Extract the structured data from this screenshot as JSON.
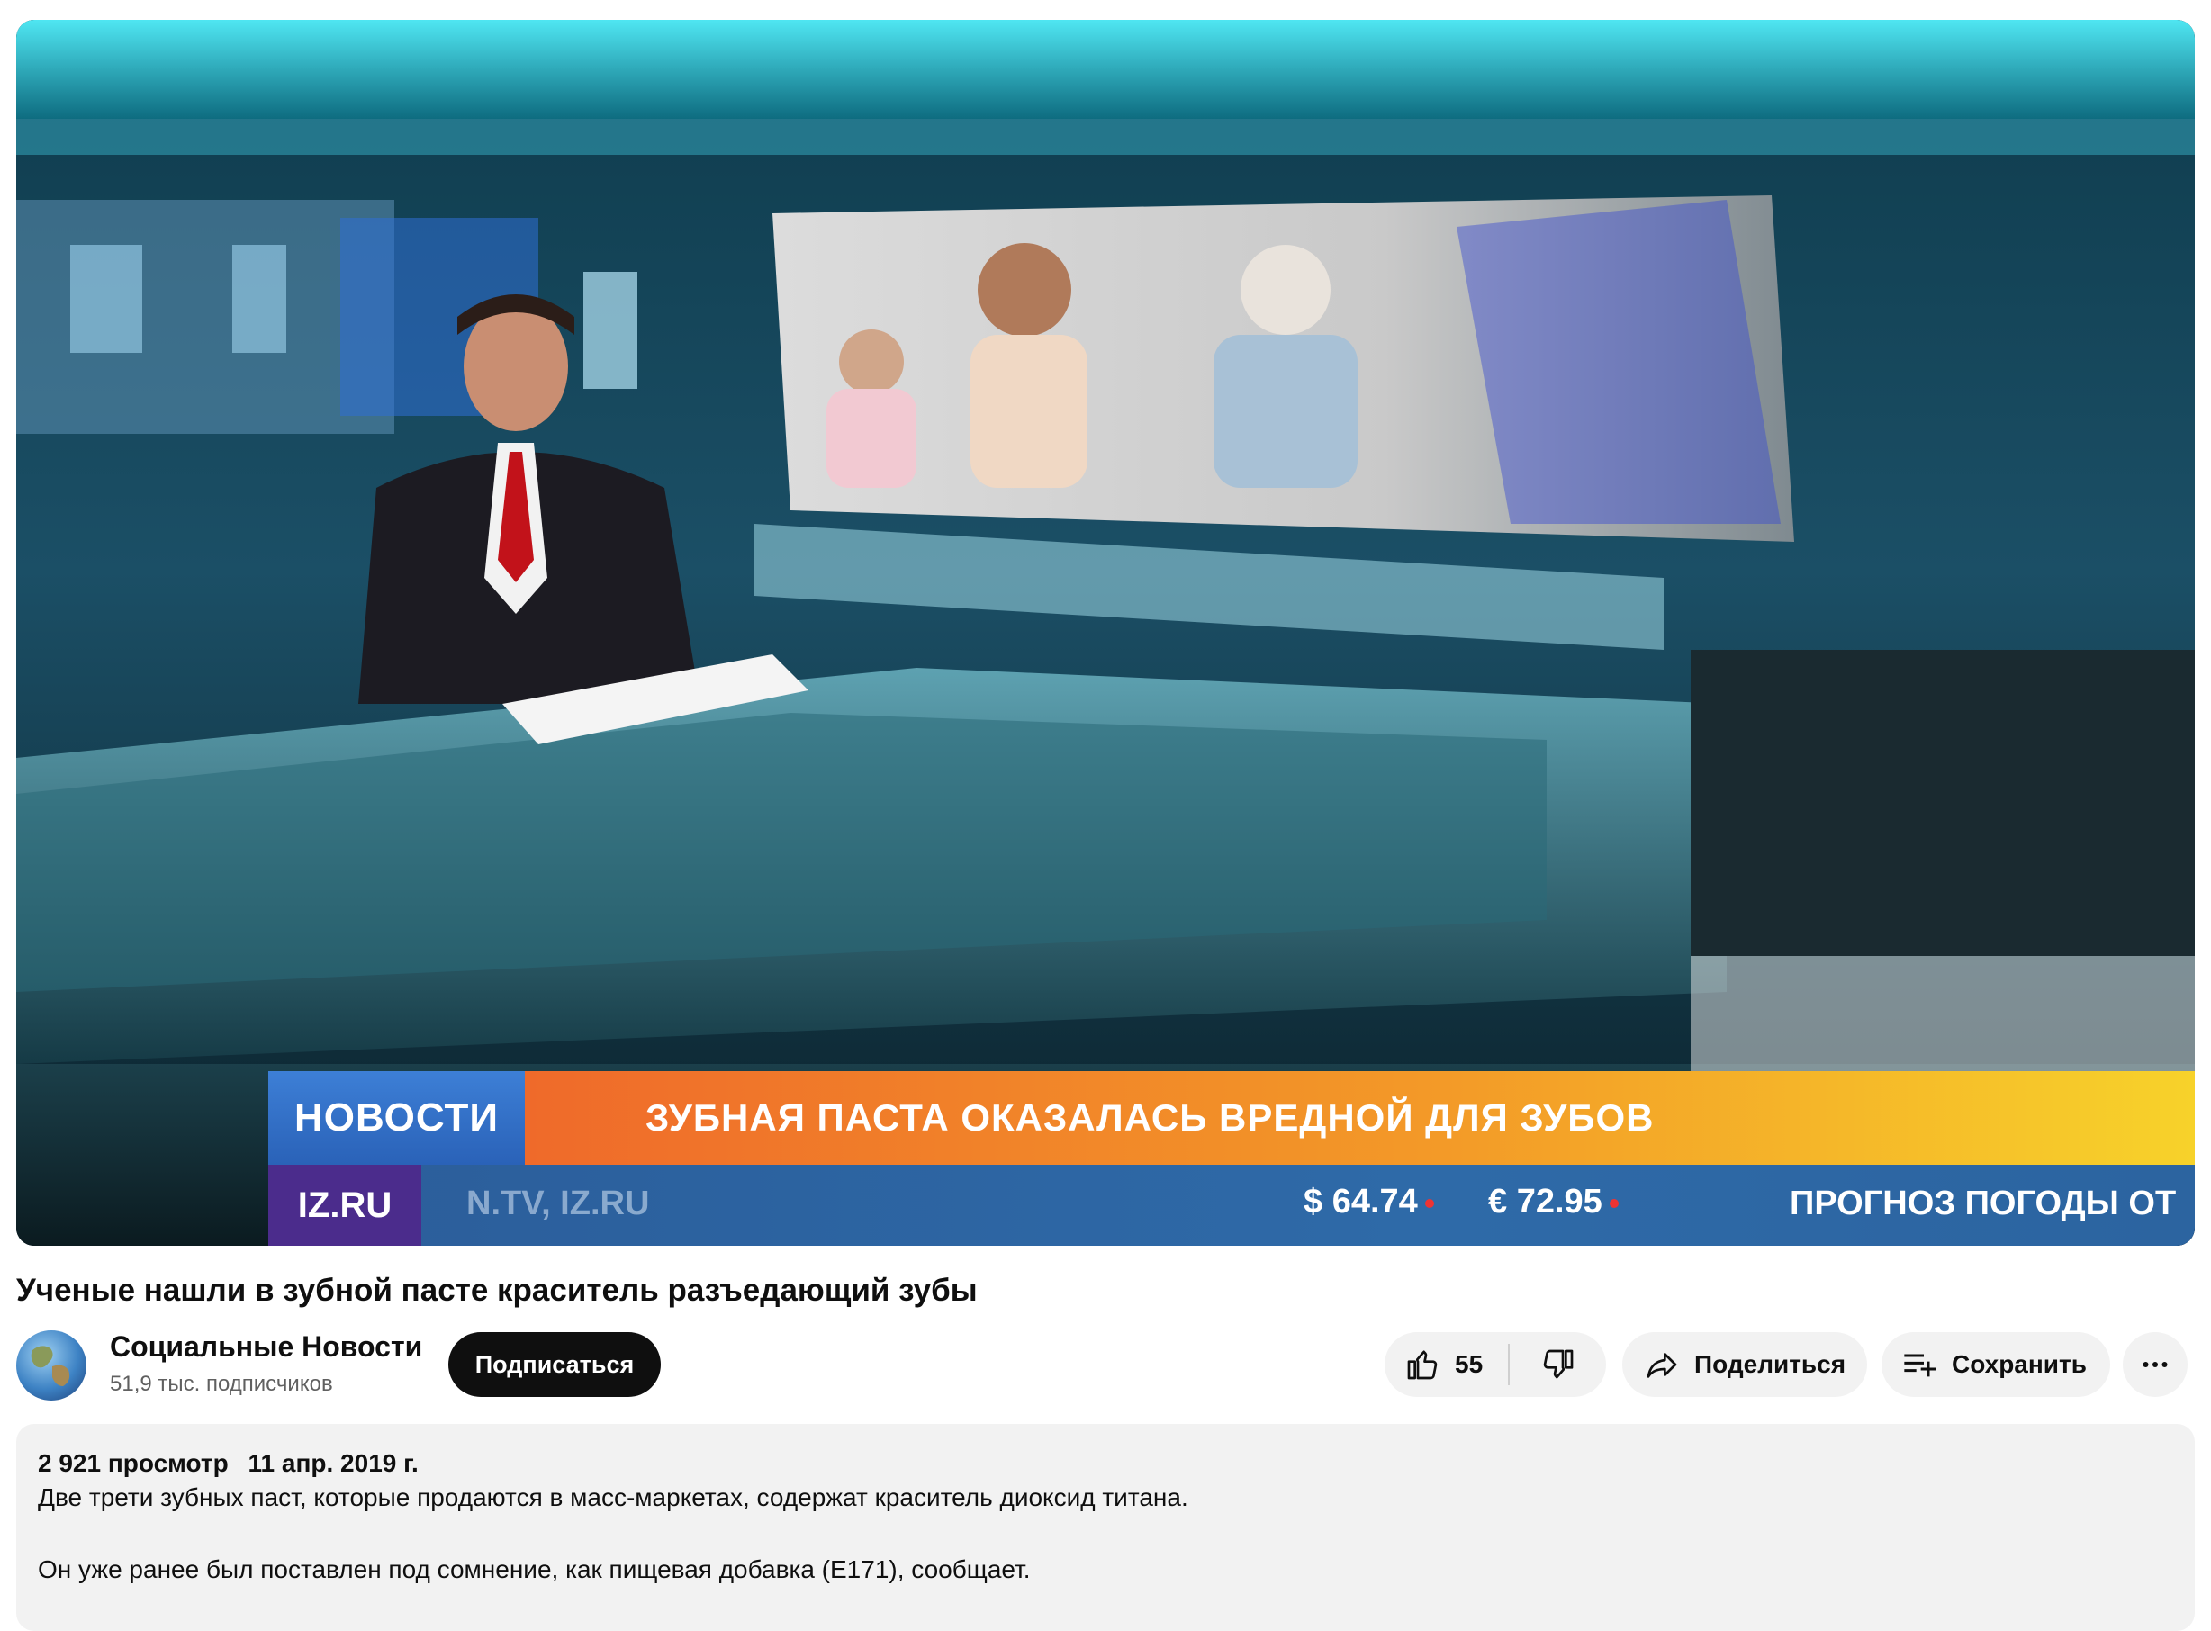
{
  "video": {
    "ticker": {
      "section_label": "НОВОСТИ",
      "headline": "ЗУБНАЯ ПАСТА ОКАЗАЛАСЬ ВРЕДНОЙ ДЛЯ ЗУБОВ",
      "logo_text": "IZ.RU",
      "sites": "N.TV, IZ.RU",
      "usd_rate": "$ 64.74",
      "eur_rate": "€ 72.95",
      "weather": "ПРОГНОЗ ПОГОДЫ ОТ"
    }
  },
  "title": "Ученые нашли в зубной пасте краситель разъедающий зубы",
  "channel": {
    "name": "Социальные Новости",
    "subscribers": "51,9 тыс. подписчиков"
  },
  "actions": {
    "subscribe": "Подписаться",
    "likes": "55",
    "share": "Поделиться",
    "save": "Сохранить"
  },
  "description": {
    "views": "2 921 просмотр",
    "date": "11 апр. 2019 г.",
    "line1": "Две трети зубных паст, которые продаются в масс-маркетах, содержат краситель диоксид титана.",
    "line2": "Он уже ранее был поставлен под сомнение, как пищевая добавка (E171), сообщает."
  },
  "colors": {
    "subscribe_bg": "#0f0f0f",
    "pill_bg": "#f2f2f2",
    "ticker_orange": "#ef6a2a",
    "ticker_blue": "#2e6aa8"
  }
}
